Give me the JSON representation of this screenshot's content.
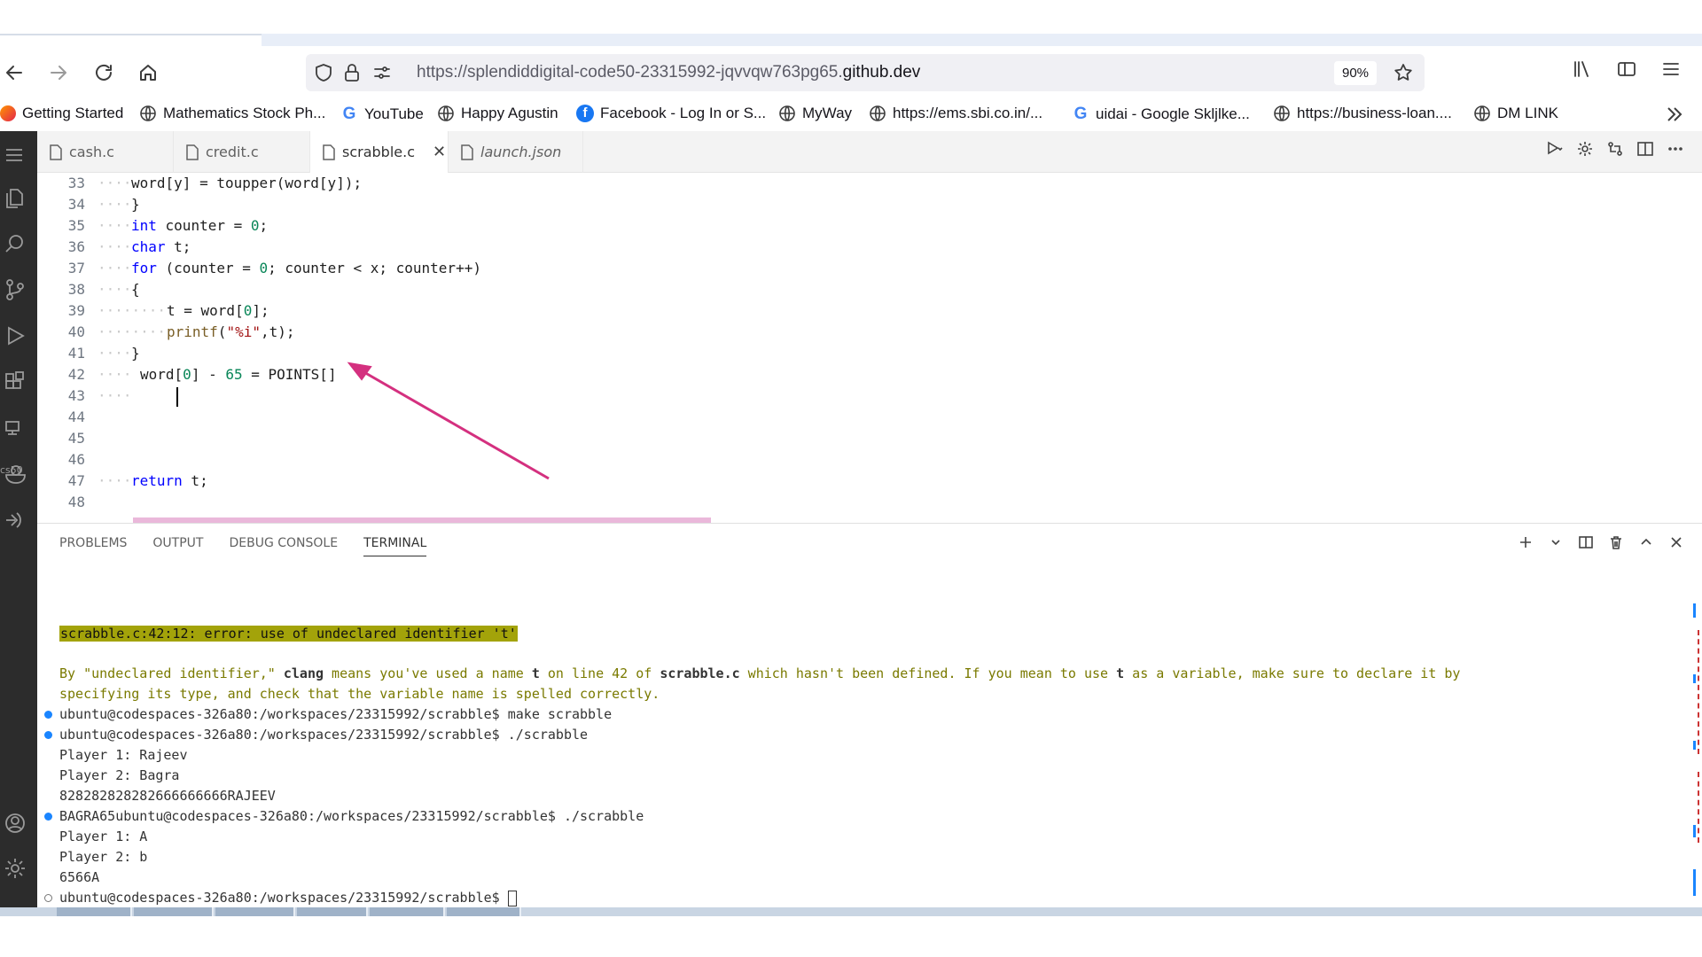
{
  "browser": {
    "url_prefix": "https://splendiddigital-code50-23315992-jqvvqw763pg65.",
    "url_domain": "github.dev",
    "zoom": "90%"
  },
  "bookmarks": [
    {
      "label": "Getting Started",
      "icon": "firefox-icon"
    },
    {
      "label": "Mathematics Stock Ph...",
      "icon": "globe-icon"
    },
    {
      "label": "YouTube",
      "icon": "google-icon"
    },
    {
      "label": "Happy Agustin",
      "icon": "globe-icon"
    },
    {
      "label": "Facebook - Log In or S...",
      "icon": "facebook-icon"
    },
    {
      "label": "MyWay",
      "icon": "globe-icon"
    },
    {
      "label": "https://ems.sbi.co.in/...",
      "icon": "globe-icon"
    },
    {
      "label": "uidai - Google Skljlke...",
      "icon": "google-icon"
    },
    {
      "label": "https://business-loan....",
      "icon": "globe-icon"
    },
    {
      "label": "DM LINK",
      "icon": "globe-icon"
    }
  ],
  "editor": {
    "tabs": [
      {
        "label": "cash.c"
      },
      {
        "label": "credit.c"
      },
      {
        "label": "scrabble.c",
        "close": "✕"
      },
      {
        "label": "launch.json"
      }
    ],
    "line_numbers": [
      "33",
      "34",
      "35",
      "36",
      "37",
      "38",
      "39",
      "40",
      "41",
      "42",
      "43",
      "44",
      "45",
      "46",
      "47",
      "48"
    ],
    "lines": {
      "l33": "word[y] = toupper(word[y]);",
      "l34": "}",
      "l35a": "int",
      "l35b": " counter = ",
      "l35c": "0",
      "l35d": ";",
      "l36a": "char",
      "l36b": " t;",
      "l37a": "for",
      "l37b": " (counter = ",
      "l37c": "0",
      "l37d": "; counter < x; counter++)",
      "l38": "{",
      "l39a": "t = word[",
      "l39b": "0",
      "l39c": "];",
      "l40a": "printf",
      "l40b": "(",
      "l40c": "\"%i\"",
      "l40d": ",t);",
      "l41": "}",
      "l42a": "word[",
      "l42b": "0",
      "l42c": "] - ",
      "l42d": "65",
      "l42e": " = POINTS[]",
      "l47a": "return",
      "l47b": " t;"
    }
  },
  "panel": {
    "tabs": [
      "PROBLEMS",
      "OUTPUT",
      "DEBUG CONSOLE",
      "TERMINAL"
    ],
    "terminal": {
      "error_line": "scrabble.c:42:12: error: use of undeclared identifier 't'",
      "help1_a": "By \"undeclared identifier,\" ",
      "help1_b": "clang",
      "help1_c": " means you've used a name ",
      "help1_d": "t",
      "help1_e": " on line 42 of ",
      "help1_f": "scrabble.c",
      "help1_g": " which hasn't been defined. If you mean to use ",
      "help1_h": "t",
      "help1_i": " as a variable, make sure to declare it by",
      "help2": "specifying its type, and check that the variable name is spelled correctly.",
      "cmd1": "ubuntu@codespaces-326a80:/workspaces/23315992/scrabble$ make scrabble",
      "cmd2": "ubuntu@codespaces-326a80:/workspaces/23315992/scrabble$ ./scrabble",
      "out1": "Player 1: Rajeev",
      "out2": "Player 2: Bagra",
      "out3": "828282828282666666666RAJEEV",
      "cmd3": "BAGRA65ubuntu@codespaces-326a80:/workspaces/23315992/scrabble$ ./scrabble",
      "out4": "Player 1: A",
      "out5": "Player 2: b",
      "out6": "6566A",
      "prompt": "ubuntu@codespaces-326a80:/workspaces/23315992/scrabble$ "
    }
  },
  "colors": {
    "highlight": "#dd8cc4",
    "arrow": "#d4307f",
    "keyword": "#0000ff",
    "number": "#098658",
    "string": "#a31515",
    "error_bg": "#a3a30a"
  }
}
